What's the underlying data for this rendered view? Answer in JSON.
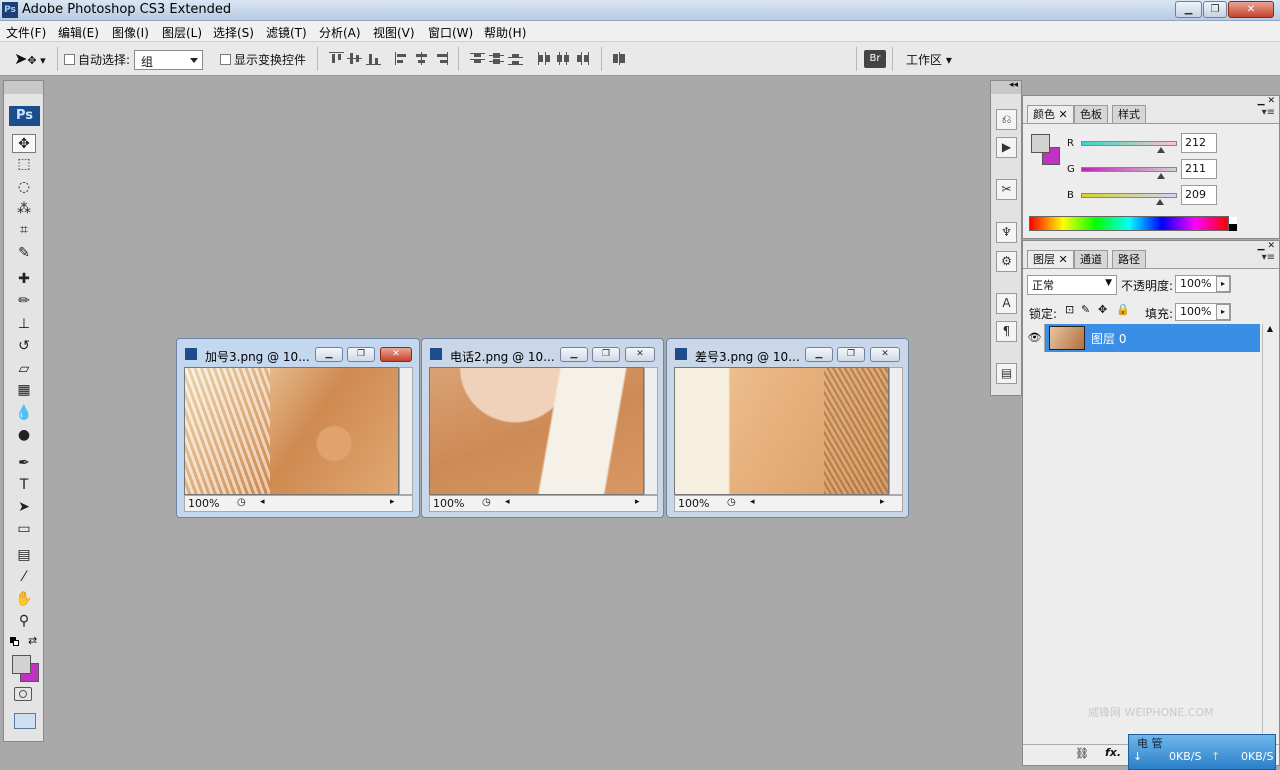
{
  "window": {
    "title": "Adobe Photoshop CS3 Extended",
    "app_icon": "Ps",
    "controls": [
      "minimize-icon",
      "restore-icon",
      "close-icon"
    ]
  },
  "menu": [
    "文件(F)",
    "编辑(E)",
    "图像(I)",
    "图层(L)",
    "选择(S)",
    "滤镜(T)",
    "分析(A)",
    "视图(V)",
    "窗口(W)",
    "帮助(H)"
  ],
  "options": {
    "auto_select_label": "自动选择:",
    "auto_select_value": "组",
    "show_transform_label": "显示变换控件",
    "workspace_label": "工作区"
  },
  "toolbox": {
    "logo": "Ps",
    "tools": [
      {
        "name": "move-tool-icon",
        "glyph": "✥"
      },
      {
        "name": "marquee-tool-icon",
        "glyph": "⬚"
      },
      {
        "name": "lasso-tool-icon",
        "glyph": "◌"
      },
      {
        "name": "magic-wand-tool-icon",
        "glyph": "⁂"
      },
      {
        "name": "crop-tool-icon",
        "glyph": "⌗"
      },
      {
        "name": "slice-tool-icon",
        "glyph": "✎"
      },
      {
        "name": "healing-brush-tool-icon",
        "glyph": "✚"
      },
      {
        "name": "brush-tool-icon",
        "glyph": "✏"
      },
      {
        "name": "clone-stamp-tool-icon",
        "glyph": "⊥"
      },
      {
        "name": "history-brush-tool-icon",
        "glyph": "↺"
      },
      {
        "name": "eraser-tool-icon",
        "glyph": "▱"
      },
      {
        "name": "gradient-tool-icon",
        "glyph": "▦"
      },
      {
        "name": "blur-tool-icon",
        "glyph": "💧"
      },
      {
        "name": "dodge-tool-icon",
        "glyph": "●"
      },
      {
        "name": "pen-tool-icon",
        "glyph": "✒"
      },
      {
        "name": "type-tool-icon",
        "glyph": "T"
      },
      {
        "name": "path-selection-tool-icon",
        "glyph": "➤"
      },
      {
        "name": "shape-tool-icon",
        "glyph": "▭"
      },
      {
        "name": "notes-tool-icon",
        "glyph": "▤"
      },
      {
        "name": "eyedropper-tool-icon",
        "glyph": "⁄"
      },
      {
        "name": "hand-tool-icon",
        "glyph": "✋"
      },
      {
        "name": "zoom-tool-icon",
        "glyph": "⚲"
      }
    ],
    "foreground_color": "#d4d3d1",
    "background_color": "#c032c0"
  },
  "documents": [
    {
      "title": "加号3.png @ 10...",
      "zoom": "100%",
      "active": true
    },
    {
      "title": "电话2.png @ 10...",
      "zoom": "100%",
      "active": false
    },
    {
      "title": "差号3.png @ 10...",
      "zoom": "100%",
      "active": false
    }
  ],
  "color_panel": {
    "tabs": [
      "颜色",
      "色板",
      "样式"
    ],
    "channels": [
      {
        "label": "R",
        "value": "212",
        "gradient": "linear-gradient(90deg,#3ad3c9,#ffc6c4)",
        "fraction": 0.83
      },
      {
        "label": "G",
        "value": "211",
        "gradient": "linear-gradient(90deg,#c023b9,#d4d2d0)",
        "fraction": 0.83
      },
      {
        "label": "B",
        "value": "209",
        "gradient": "linear-gradient(90deg,#d4d22f,#d4d3ff)",
        "fraction": 0.82
      }
    ],
    "foreground": "#d4d3d1",
    "background": "#c032c0"
  },
  "layers_panel": {
    "tabs": [
      "图层",
      "通道",
      "路径"
    ],
    "blend_mode": "正常",
    "opacity_label": "不透明度:",
    "opacity_value": "100%",
    "lock_label": "锁定:",
    "fill_label": "填充:",
    "fill_value": "100%",
    "layers": [
      {
        "name": "图层 0",
        "visible": true,
        "selected": true
      }
    ]
  },
  "watermark": "威锋网 WEIPHONE.COM",
  "network": {
    "label": "电 管",
    "down": "0KB/S",
    "up": "0KB/S"
  }
}
